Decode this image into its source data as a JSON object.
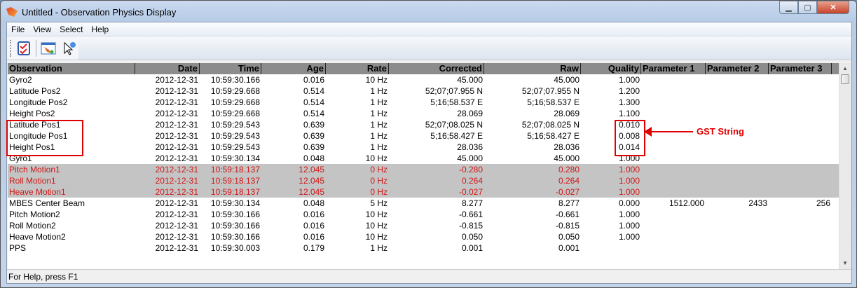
{
  "window": {
    "title": "Untitled - Observation Physics Display",
    "controls": {
      "minimize": "minimize",
      "maximize": "maximize",
      "close": "close"
    }
  },
  "menu": [
    "File",
    "View",
    "Select",
    "Help"
  ],
  "toolbar": [
    {
      "icon": "checklist-icon"
    },
    {
      "icon": "display-window-icon"
    },
    {
      "icon": "help-pointer-icon"
    }
  ],
  "columns": [
    "Observation",
    "Date",
    "Time",
    "Age",
    "Rate",
    "Corrected",
    "Raw",
    "Quality",
    "Parameter 1",
    "Parameter 2",
    "Parameter 3"
  ],
  "rows": [
    {
      "stale": false,
      "cells": [
        "Gyro2",
        "2012-12-31",
        "10:59:30.166",
        "0.016",
        "10 Hz",
        "45.000",
        "45.000",
        "1.000",
        "",
        "",
        ""
      ]
    },
    {
      "stale": false,
      "cells": [
        "Latitude Pos2",
        "2012-12-31",
        "10:59:29.668",
        "0.514",
        "1 Hz",
        "52;07;07.955 N",
        "52;07;07.955 N",
        "1.200",
        "",
        "",
        ""
      ]
    },
    {
      "stale": false,
      "cells": [
        "Longitude Pos2",
        "2012-12-31",
        "10:59:29.668",
        "0.514",
        "1 Hz",
        "5;16;58.537 E",
        "5;16;58.537 E",
        "1.300",
        "",
        "",
        ""
      ]
    },
    {
      "stale": false,
      "cells": [
        "Height Pos2",
        "2012-12-31",
        "10:59:29.668",
        "0.514",
        "1 Hz",
        "28.069",
        "28.069",
        "1.100",
        "",
        "",
        ""
      ]
    },
    {
      "stale": false,
      "cells": [
        "Latitude Pos1",
        "2012-12-31",
        "10:59:29.543",
        "0.639",
        "1 Hz",
        "52;07;08.025 N",
        "52;07;08.025 N",
        "0.010",
        "",
        "",
        ""
      ]
    },
    {
      "stale": false,
      "cells": [
        "Longitude Pos1",
        "2012-12-31",
        "10:59:29.543",
        "0.639",
        "1 Hz",
        "5;16;58.427 E",
        "5;16;58.427 E",
        "0.008",
        "",
        "",
        ""
      ]
    },
    {
      "stale": false,
      "cells": [
        "Height Pos1",
        "2012-12-31",
        "10:59:29.543",
        "0.639",
        "1 Hz",
        "28.036",
        "28.036",
        "0.014",
        "",
        "",
        ""
      ]
    },
    {
      "stale": false,
      "cells": [
        "Gyro1",
        "2012-12-31",
        "10:59:30.134",
        "0.048",
        "10 Hz",
        "45.000",
        "45.000",
        "1.000",
        "",
        "",
        ""
      ]
    },
    {
      "stale": true,
      "cells": [
        "Pitch Motion1",
        "2012-12-31",
        "10:59:18.137",
        "12.045",
        "0 Hz",
        "-0.280",
        "0.280",
        "1.000",
        "",
        "",
        ""
      ]
    },
    {
      "stale": true,
      "cells": [
        "Roll Motion1",
        "2012-12-31",
        "10:59:18.137",
        "12.045",
        "0 Hz",
        "0.264",
        "0.264",
        "1.000",
        "",
        "",
        ""
      ]
    },
    {
      "stale": true,
      "cells": [
        "Heave Motion1",
        "2012-12-31",
        "10:59:18.137",
        "12.045",
        "0 Hz",
        "-0.027",
        "-0.027",
        "1.000",
        "",
        "",
        ""
      ]
    },
    {
      "stale": false,
      "cells": [
        "MBES Center Beam",
        "2012-12-31",
        "10:59:30.134",
        "0.048",
        "5 Hz",
        "8.277",
        "8.277",
        "0.000",
        "1512.000",
        "2433",
        "256"
      ]
    },
    {
      "stale": false,
      "cells": [
        "Pitch Motion2",
        "2012-12-31",
        "10:59:30.166",
        "0.016",
        "10 Hz",
        "-0.661",
        "-0.661",
        "1.000",
        "",
        "",
        ""
      ]
    },
    {
      "stale": false,
      "cells": [
        "Roll Motion2",
        "2012-12-31",
        "10:59:30.166",
        "0.016",
        "10 Hz",
        "-0.815",
        "-0.815",
        "1.000",
        "",
        "",
        ""
      ]
    },
    {
      "stale": false,
      "cells": [
        "Heave Motion2",
        "2012-12-31",
        "10:59:30.166",
        "0.016",
        "10 Hz",
        "0.050",
        "0.050",
        "1.000",
        "",
        "",
        ""
      ]
    },
    {
      "stale": false,
      "cells": [
        "PPS",
        "2012-12-31",
        "10:59:30.003",
        "0.179",
        "1 Hz",
        "0.001",
        "0.001",
        "",
        "",
        "",
        ""
      ]
    }
  ],
  "status": "For Help, press F1",
  "annotation": {
    "label": "GST String",
    "color": "#e00000"
  },
  "colors": {
    "stale_text": "#d01818",
    "stale_bg": "#c4c4c4",
    "header_bg": "#8c8c8c"
  }
}
